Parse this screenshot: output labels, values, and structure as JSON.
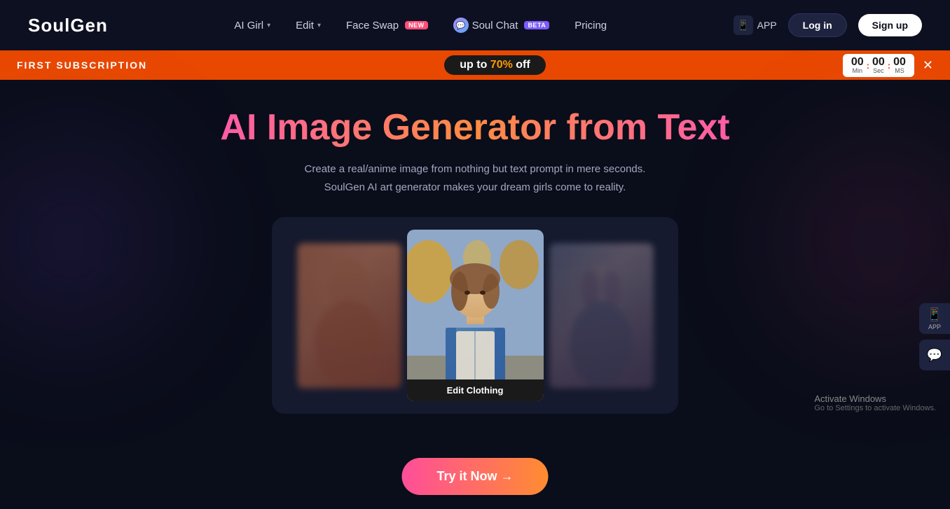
{
  "brand": {
    "logo": "SoulGen"
  },
  "navbar": {
    "items": [
      {
        "label": "AI Girl",
        "has_dropdown": true,
        "badge": null
      },
      {
        "label": "Edit",
        "has_dropdown": true,
        "badge": null
      },
      {
        "label": "Face Swap",
        "has_dropdown": false,
        "badge": "NEW"
      },
      {
        "label": "Soul Chat",
        "has_dropdown": false,
        "badge": "Beta",
        "has_icon": true
      },
      {
        "label": "Pricing",
        "has_dropdown": false,
        "badge": null
      }
    ],
    "app_label": "APP",
    "login_label": "Log in",
    "signup_label": "Sign up"
  },
  "promo_banner": {
    "left_text": "FIRST SUBSCRIPTION",
    "discount_text": "up to 70% off",
    "discount_highlight": "70%",
    "timer": {
      "min": "00",
      "sec": "00",
      "ms": "00",
      "min_label": "Min",
      "sec_label": "Sec",
      "ms_label": "MS"
    }
  },
  "hero": {
    "title": "AI Image Generator from Text",
    "subtitle_line1": "Create a real/anime image from nothing but text prompt in mere seconds.",
    "subtitle_line2": "SoulGen AI art generator makes your dream girls come to reality.",
    "carousel_label": "Edit Clothing",
    "try_button": "Try it Now →"
  },
  "activate_windows": {
    "title": "Activate Windows",
    "subtitle": "Go to Settings to activate Windows."
  }
}
